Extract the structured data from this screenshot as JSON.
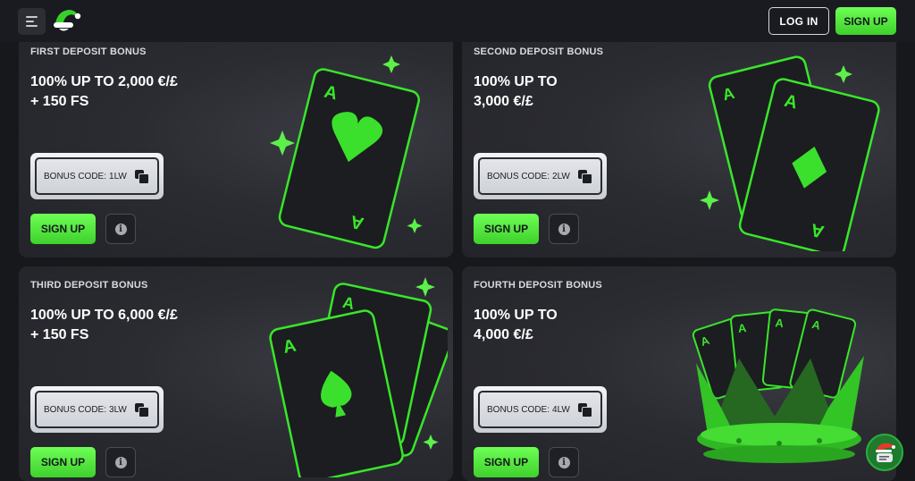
{
  "header": {
    "login_label": "LOG IN",
    "signup_label": "SIGN UP"
  },
  "icons": {
    "menu": "hamburger-menu-icon",
    "logo": "santa-hat-logo-icon",
    "copy": "copy-icon",
    "info": "info-icon",
    "chat": "chat-icon"
  },
  "colors": {
    "accent": "#4ee53a",
    "background": "#17181c",
    "card": "#2b2c32"
  },
  "bonuses": [
    {
      "label": "FIRST DEPOSIT BONUS",
      "title_line1": "100% UP TO 2,000 €/£",
      "title_line2": "+ 150 FS",
      "code_label": "BONUS CODE:",
      "code_value": "1LW",
      "signup_label": "SIGN UP",
      "info_glyph": "i"
    },
    {
      "label": "SECOND DEPOSIT BONUS",
      "title_line1": "100% UP TO",
      "title_line2": "3,000 €/£",
      "code_label": "BONUS CODE:",
      "code_value": "2LW",
      "signup_label": "SIGN UP",
      "info_glyph": "i"
    },
    {
      "label": "THIRD DEPOSIT BONUS",
      "title_line1": "100% UP TO 6,000 €/£",
      "title_line2": "+ 150 FS",
      "code_label": "BONUS CODE:",
      "code_value": "3LW",
      "signup_label": "SIGN UP",
      "info_glyph": "i"
    },
    {
      "label": "FOURTH DEPOSIT BONUS",
      "title_line1": "100% UP TO",
      "title_line2": "4,000 €/£",
      "code_label": "BONUS CODE:",
      "code_value": "4LW",
      "signup_label": "SIGN UP",
      "info_glyph": "i"
    }
  ],
  "card_art": {
    "ace_letter": "A"
  }
}
